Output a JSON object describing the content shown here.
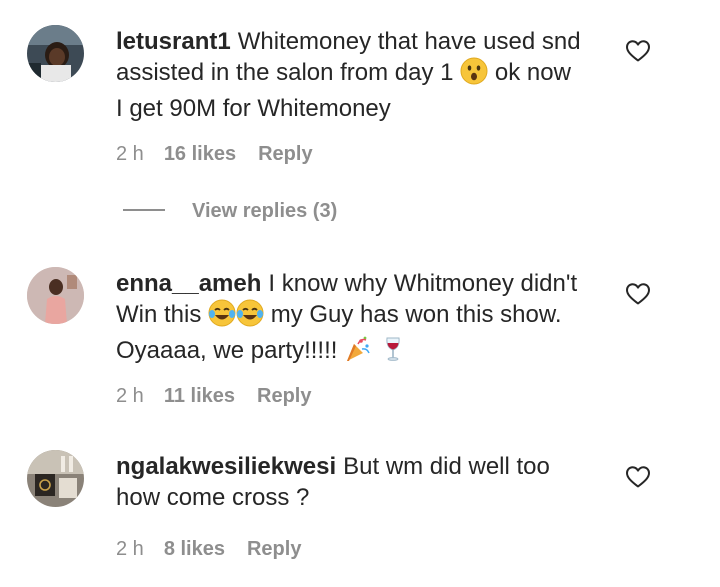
{
  "comments": [
    {
      "username": "letusrant1",
      "text_line1": "Whitemoney that have used snd",
      "text_line2a": "assisted in the salon from day 1",
      "text_line2b": "ok now",
      "text_line3": "I get 90M for Whitemoney",
      "emoji_icons": [
        "astonished-face-icon"
      ],
      "time": "2 h",
      "likes": "16 likes",
      "reply_label": "Reply",
      "view_replies": "View replies (3)"
    },
    {
      "username": "enna__ameh",
      "text_line1": "I know why Whitmoney didn't",
      "text_line2a": "Win this",
      "text_line2b": "my Guy has won this show.",
      "text_line3": "Oyaaaa, we party!!!!!",
      "emoji_icons": [
        "tears-of-joy-icon",
        "tears-of-joy-icon",
        "party-popper-icon",
        "wine-glass-icon"
      ],
      "time": "2 h",
      "likes": "11 likes",
      "reply_label": "Reply"
    },
    {
      "username": "ngalakwesiliekwesi",
      "text_line1": "But wm did well too",
      "text_line2": "how come cross ?",
      "time": "2 h",
      "likes": "8 likes",
      "reply_label": "Reply"
    }
  ],
  "colors": {
    "text": "#262626",
    "meta": "#8e8e8e",
    "background": "#ffffff"
  }
}
